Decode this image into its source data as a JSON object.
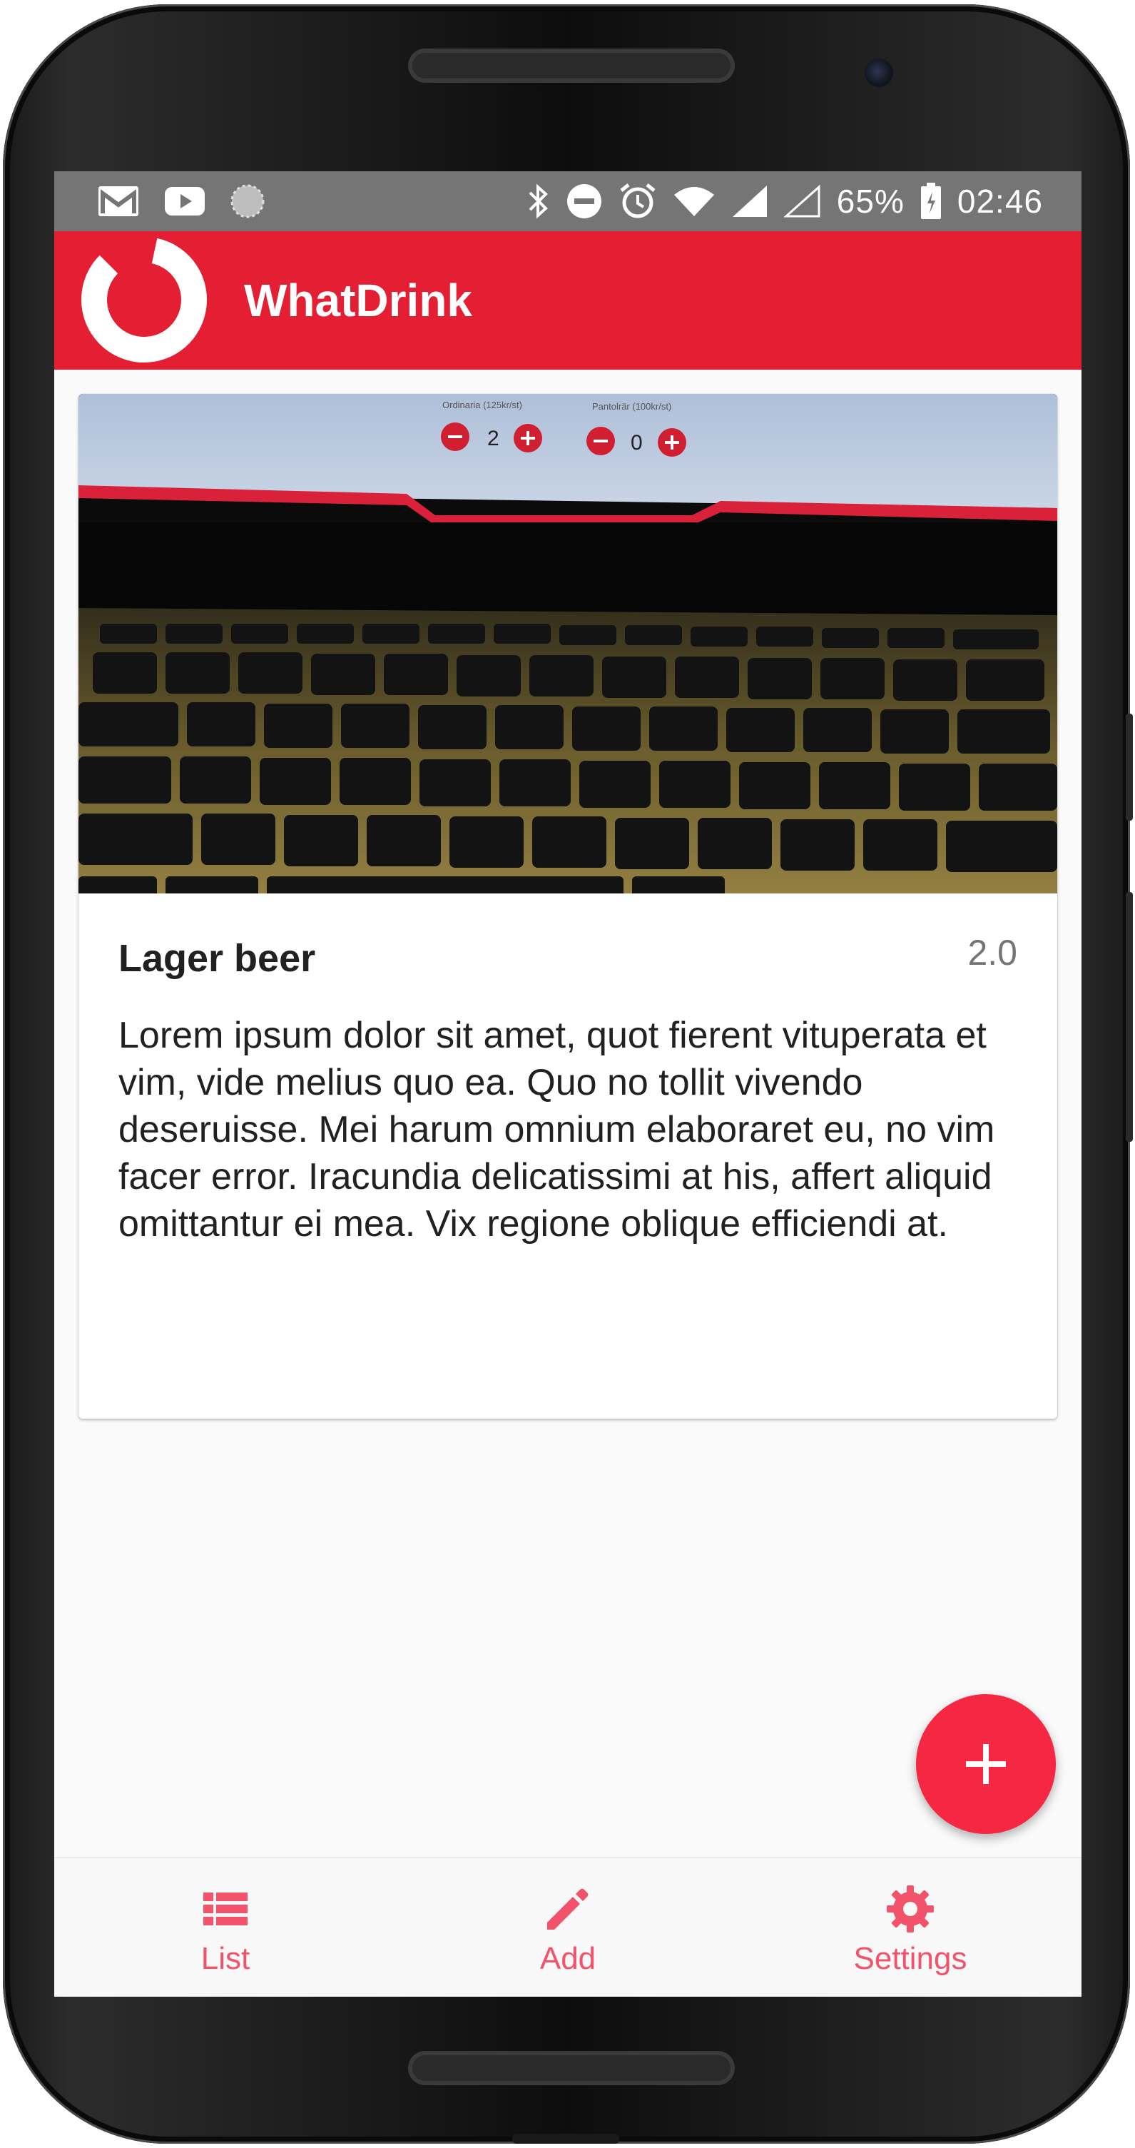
{
  "status_bar": {
    "left_icons": [
      "gmail-icon",
      "youtube-icon",
      "loading-icon"
    ],
    "right_icons": [
      "bluetooth-icon",
      "do-not-disturb-icon",
      "alarm-icon",
      "wifi-icon",
      "cell-signal-icon",
      "cell-signal-empty-icon",
      "battery-icon"
    ],
    "battery": "65%",
    "time": "02:46"
  },
  "app_bar": {
    "title": "WhatDrink",
    "logo_icon": "app-logo-ring-icon"
  },
  "card": {
    "image_icon": "laptop-keyboard-photo",
    "title": "Lager beer",
    "rating": "2.0",
    "description": "Lorem ipsum dolor sit amet, quot fierent vituperata et vim, vide melius quo ea. Quo no tollit vivendo deseruisse. Mei harum omnium elaboraret eu, no vim facer error. Iracundia delicatissimi at his, affert aliquid omittantur ei mea. Vix regione oblique efficiendi at."
  },
  "fab": {
    "icon": "plus-icon"
  },
  "bottom_nav": {
    "items": [
      {
        "label": "List",
        "icon": "list-icon"
      },
      {
        "label": "Add",
        "icon": "pencil-icon"
      },
      {
        "label": "Settings",
        "icon": "gear-icon"
      }
    ]
  },
  "colors": {
    "app_bar": "#e41e33",
    "accent": "#f52743",
    "nav_label": "#f2536a",
    "status_bar": "#757575"
  }
}
